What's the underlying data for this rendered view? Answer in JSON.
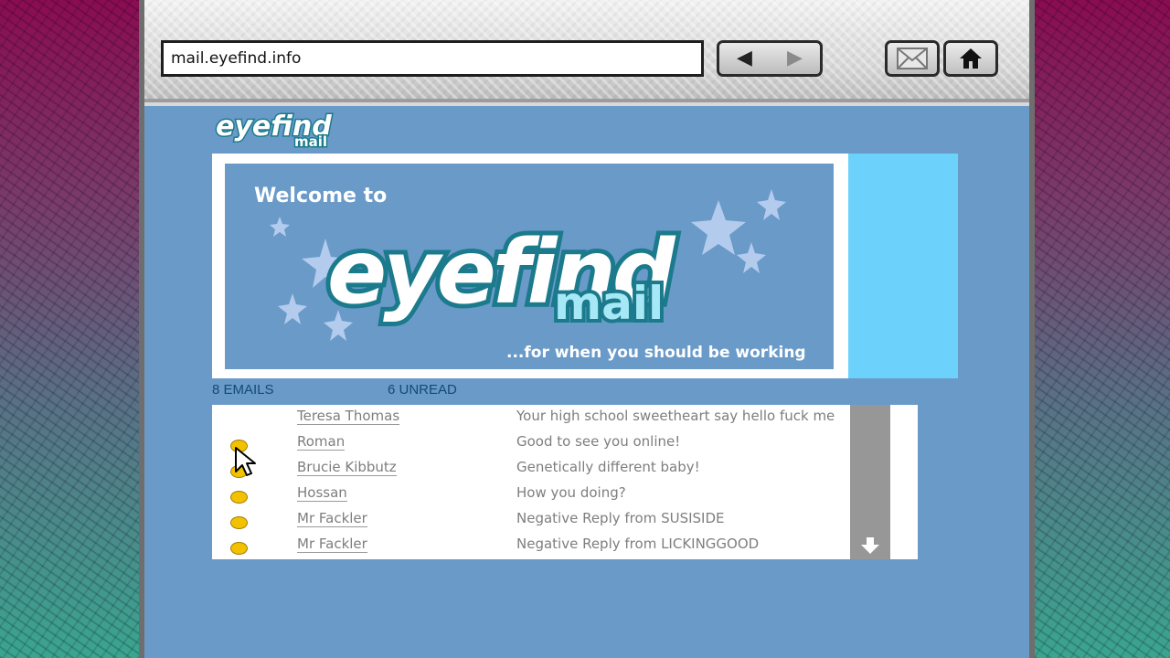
{
  "browser": {
    "address": "mail.eyefind.info",
    "nav": {
      "back_icon": "back-arrow-icon",
      "forward_icon": "forward-arrow-icon"
    },
    "buttons": {
      "mail_icon": "envelope-icon",
      "home_icon": "home-icon"
    }
  },
  "logo": {
    "line1": "eyefind",
    "line2": "mail"
  },
  "banner": {
    "welcome": "Welcome to",
    "brand_word": "eyefind",
    "brand_sub": "mail",
    "tagline": "...for when you should be working"
  },
  "counts": {
    "emails": "8 EMAILS",
    "unread": "6 UNREAD"
  },
  "inbox": {
    "rows": [
      {
        "sender": "Teresa Thomas",
        "subject": "Your high school sweetheart say hello fuck me",
        "unread": false
      },
      {
        "sender": "Roman",
        "subject": "Good to see you online!",
        "unread": true
      },
      {
        "sender": "Brucie Kibbutz",
        "subject": "Genetically different baby!",
        "unread": true
      },
      {
        "sender": "Hossan",
        "subject": "How you doing?",
        "unread": true
      },
      {
        "sender": "Mr Fackler",
        "subject": "Negative Reply from SUSISIDE",
        "unread": true
      },
      {
        "sender": "Mr Fackler",
        "subject": "Negative Reply from LICKINGGOOD",
        "unread": true
      }
    ]
  },
  "colors": {
    "page_bg": "#6a9ac8",
    "ad_slot": "#6dd2fb",
    "unread_dot": "#f2c200",
    "count_text": "#134a78",
    "brand_yellow": "#f5c400",
    "brand_teal": "#1b7a8c"
  }
}
